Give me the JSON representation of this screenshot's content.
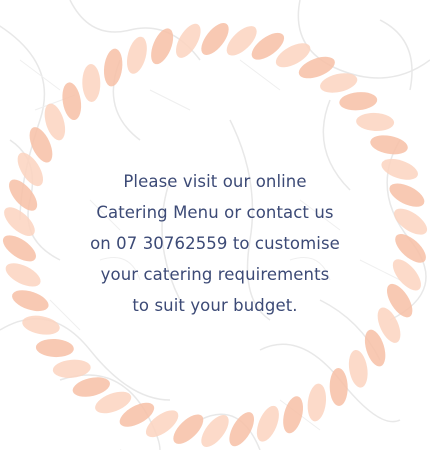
{
  "promo": {
    "message": "Please  visit our online\nCatering Menu or contact us\non 07 30762559 to customise\nyour catering requirements\nto suit your budget."
  },
  "colors": {
    "rope": "#fbd4c0",
    "rope_shade": "#f7c0a6",
    "text": "#3c4a76",
    "sketch": "#e6e6e6"
  }
}
